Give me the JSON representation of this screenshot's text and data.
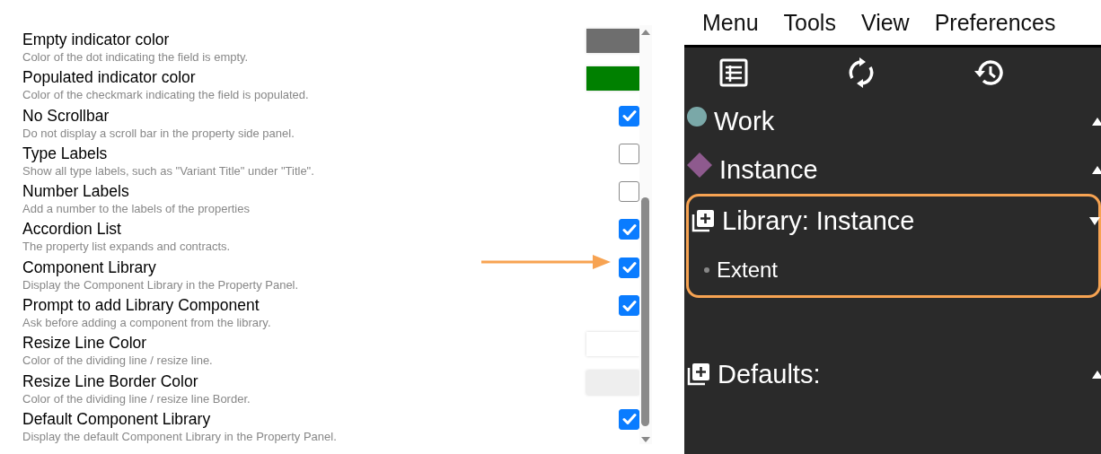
{
  "settings": [
    {
      "label": "Empty indicator color",
      "description": "Color of the dot indicating the field is empty.",
      "kind": "swatch",
      "color": "#6e6e6e"
    },
    {
      "label": "Populated indicator color",
      "description": "Color of the checkmark indicating the field is populated.",
      "kind": "swatch",
      "color": "#008000"
    },
    {
      "label": "No Scrollbar",
      "description": "Do not display a scroll bar in the property side panel.",
      "kind": "checkbox",
      "checked": true
    },
    {
      "label": "Type Labels",
      "description": "Show all type labels, such as \"Variant Title\" under \"Title\".",
      "kind": "checkbox",
      "checked": false
    },
    {
      "label": "Number Labels",
      "description": "Add a number to the labels of the properties",
      "kind": "checkbox",
      "checked": false
    },
    {
      "label": "Accordion List",
      "description": "The property list expands and contracts.",
      "kind": "checkbox",
      "checked": true
    },
    {
      "label": "Component Library",
      "description": "Display the Component Library in the Property Panel.",
      "kind": "checkbox",
      "checked": true,
      "pointed": true
    },
    {
      "label": "Prompt to add Library Component",
      "description": "Ask before adding a component from the library.",
      "kind": "checkbox",
      "checked": true
    },
    {
      "label": "Resize Line Color",
      "description": "Color of the dividing line / resize line.",
      "kind": "swatch",
      "color": "#ffffff"
    },
    {
      "label": "Resize Line Border Color",
      "description": "Color of the dividing line / resize line Border.",
      "kind": "swatch",
      "color": "#eeeeee"
    },
    {
      "label": "Default Component Library",
      "description": "Display the default Component Library in the Property Panel.",
      "kind": "checkbox",
      "checked": true
    }
  ],
  "menu": [
    "Menu",
    "Tools",
    "View",
    "Preferences"
  ],
  "tree": [
    {
      "label": "Work",
      "kind": "dot",
      "color": "#7aa8a8",
      "expanded": false,
      "highlighted": false
    },
    {
      "label": "Instance",
      "kind": "diamond",
      "color": "#8e5a8e",
      "expanded": false,
      "highlighted": false
    },
    {
      "label": "Library: Instance",
      "kind": "library",
      "expanded": true,
      "highlighted": true,
      "children": [
        {
          "label": "Extent"
        }
      ]
    },
    {
      "label": "Defaults:",
      "kind": "library",
      "expanded": false,
      "highlighted": false
    }
  ]
}
